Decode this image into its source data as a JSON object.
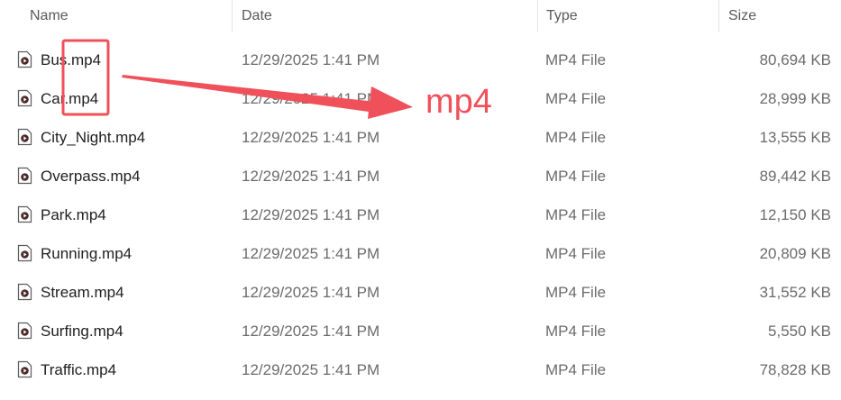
{
  "columns": {
    "name": "Name",
    "date": "Date",
    "type": "Type",
    "size": "Size"
  },
  "sort_indicator": "^",
  "files": [
    {
      "name": "Bus.mp4",
      "date": "12/29/2025 1:41 PM",
      "type": "MP4 File",
      "size": "80,694 KB"
    },
    {
      "name": "Car.mp4",
      "date": "12/29/2025 1:41 PM",
      "type": "MP4 File",
      "size": "28,999 KB"
    },
    {
      "name": "City_Night.mp4",
      "date": "12/29/2025 1:41 PM",
      "type": "MP4 File",
      "size": "13,555 KB"
    },
    {
      "name": "Overpass.mp4",
      "date": "12/29/2025 1:41 PM",
      "type": "MP4 File",
      "size": "89,442 KB"
    },
    {
      "name": "Park.mp4",
      "date": "12/29/2025 1:41 PM",
      "type": "MP4 File",
      "size": "12,150 KB"
    },
    {
      "name": "Running.mp4",
      "date": "12/29/2025 1:41 PM",
      "type": "MP4 File",
      "size": "20,809 KB"
    },
    {
      "name": "Stream.mp4",
      "date": "12/29/2025 1:41 PM",
      "type": "MP4 File",
      "size": "31,552 KB"
    },
    {
      "name": "Surfing.mp4",
      "date": "12/29/2025 1:41 PM",
      "type": "MP4 File",
      "size": "5,550 KB"
    },
    {
      "name": "Traffic.mp4",
      "date": "12/29/2025 1:41 PM",
      "type": "MP4 File",
      "size": "78,828 KB"
    }
  ],
  "annotation": {
    "label": "mp4",
    "color": "#f0505a"
  },
  "file_icon": "video-file-icon"
}
